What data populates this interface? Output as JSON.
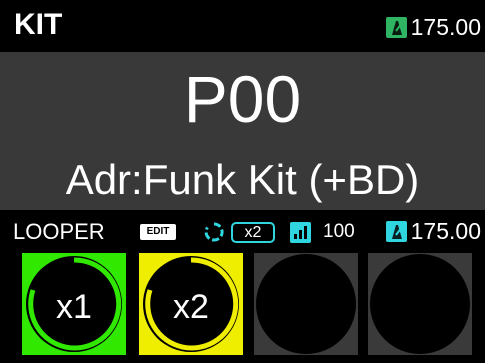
{
  "header": {
    "mode": "KIT",
    "tempo": "175.00",
    "tempo_icon": "metronome-icon"
  },
  "kit": {
    "number": "P00",
    "name": "Adr:Funk Kit (+BD)"
  },
  "looper": {
    "label": "LOOPER",
    "edit_badge": "EDIT",
    "loop_icon": "loop-icon",
    "multiplier": "x2",
    "level_icon": "level-icon",
    "level": "100",
    "tempo": "175.00",
    "tempo_icon": "metronome-icon"
  },
  "pads": [
    {
      "label": "x1",
      "state": "active",
      "color": "#30e800",
      "ring": "#30e800"
    },
    {
      "label": "x2",
      "state": "active",
      "color": "#f0ee00",
      "ring": "#f0ee00"
    },
    {
      "label": "",
      "state": "empty",
      "color": "#3a3a3a"
    },
    {
      "label": "",
      "state": "empty",
      "color": "#3a3a3a"
    }
  ],
  "colors": {
    "green": "#2fb463",
    "cyan": "#2fd6e0",
    "panel": "#393939"
  }
}
